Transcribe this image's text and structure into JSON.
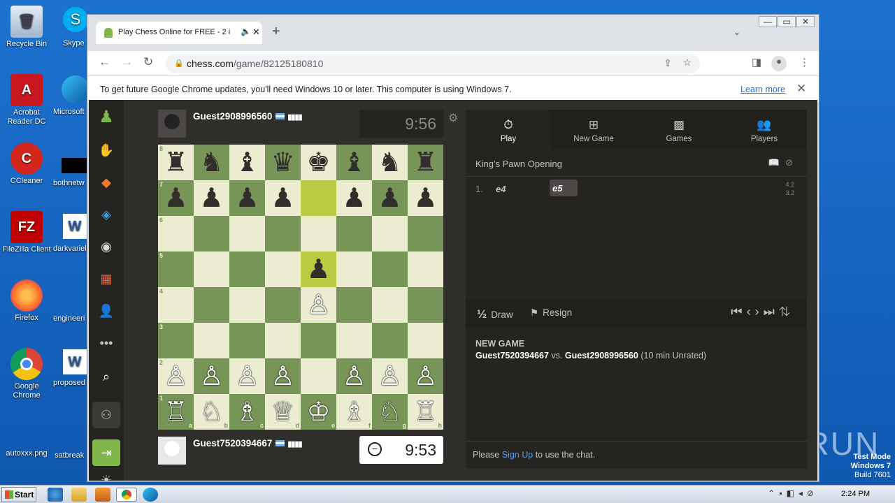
{
  "desktop": {
    "icons": [
      {
        "label": "Recycle Bin",
        "icon": "recycle-bin-icon"
      },
      {
        "label": "Acrobat Reader DC",
        "icon": "acrobat-icon"
      },
      {
        "label": "CCleaner",
        "icon": "ccleaner-icon"
      },
      {
        "label": "FileZilla Client",
        "icon": "filezilla-icon"
      },
      {
        "label": "Firefox",
        "icon": "firefox-icon"
      },
      {
        "label": "Google Chrome",
        "icon": "chrome-icon"
      },
      {
        "label": "autoxxx.png",
        "icon": "image-file-icon"
      }
    ],
    "icons_col2": [
      "Skype",
      "Microsoft",
      "bothnetw",
      "darkvariel",
      "engineeri",
      "proposed",
      "satbreak"
    ],
    "watermark": "ANY RUN",
    "win_mode": "Test Mode",
    "win_version": "Windows 7",
    "win_build": "Build 7601"
  },
  "taskbar": {
    "start_label": "Start",
    "clock": "2:24 PM"
  },
  "browser": {
    "tab_title": "Play Chess Online for FREE - 2 i",
    "url_host": "chess.com",
    "url_path": "/game/82125180810",
    "info_message": "To get future Google Chrome updates, you'll need Windows 10 or later. This computer is using Windows 7.",
    "learn_more": "Learn more"
  },
  "game": {
    "top_player": {
      "name": "Guest2908996560",
      "clock": "9:56"
    },
    "bottom_player": {
      "name": "Guest7520394667",
      "clock": "9:53"
    },
    "board": [
      [
        "♜",
        "♞",
        "♝",
        "♛",
        "♚",
        "♝",
        "♞",
        "♜"
      ],
      [
        "♟",
        "♟",
        "♟",
        "♟",
        "",
        "♟",
        "♟",
        "♟"
      ],
      [
        "",
        "",
        "",
        "",
        "",
        "",
        "",
        ""
      ],
      [
        "",
        "",
        "",
        "",
        "♟",
        "",
        "",
        ""
      ],
      [
        "",
        "",
        "",
        "",
        "♙",
        "",
        "",
        ""
      ],
      [
        "",
        "",
        "",
        "",
        "",
        "",
        "",
        ""
      ],
      [
        "♙",
        "♙",
        "♙",
        "♙",
        "",
        "♙",
        "♙",
        "♙"
      ],
      [
        "♖",
        "♘",
        "♗",
        "♕",
        "♔",
        "♗",
        "♘",
        "♖"
      ]
    ],
    "highlight": [
      "e7",
      "e5"
    ],
    "ranks": [
      "8",
      "7",
      "6",
      "5",
      "4",
      "3",
      "2",
      "1"
    ],
    "files": [
      "a",
      "b",
      "c",
      "d",
      "e",
      "f",
      "g",
      "h"
    ]
  },
  "panel": {
    "tabs": [
      {
        "label": "Play",
        "icon": "stopwatch-icon"
      },
      {
        "label": "New Game",
        "icon": "plus-square-icon"
      },
      {
        "label": "Games",
        "icon": "checkerboard-icon"
      },
      {
        "label": "Players",
        "icon": "players-icon"
      }
    ],
    "opening": "King's Pawn Opening",
    "move_no": "1.",
    "white_move": "e4",
    "black_move": "e5",
    "time_white": "4.2",
    "time_black": "3.2",
    "draw_label": "Draw",
    "draw_prefix": "½",
    "resign_label": "Resign",
    "game_header": "NEW GAME",
    "white_player": "Guest7520394667",
    "vs": "vs.",
    "black_player": "Guest2908996560",
    "game_type": "(10 min Unrated)",
    "chat_prefix": "Please",
    "chat_link": "Sign Up",
    "chat_suffix": "to use the chat."
  }
}
